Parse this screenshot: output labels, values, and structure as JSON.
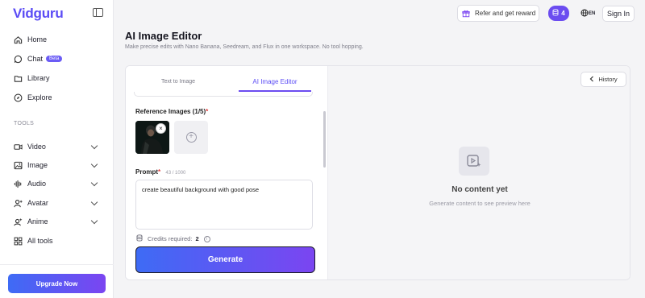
{
  "app": {
    "logo": "Vidguru"
  },
  "colors": {
    "accent": "#6b4cf0",
    "gradient_start": "#3e6bf5",
    "gradient_end": "#7b45f1",
    "required": "#e13c3c"
  },
  "sidebar": {
    "items": [
      {
        "label": "Home",
        "icon": "home-icon"
      },
      {
        "label": "Chat",
        "icon": "chat-icon",
        "badge": "Beta"
      },
      {
        "label": "Library",
        "icon": "folder-icon"
      },
      {
        "label": "Explore",
        "icon": "compass-icon"
      }
    ],
    "section_label": "TOOLS",
    "tools": [
      {
        "label": "Video",
        "icon": "video-icon"
      },
      {
        "label": "Image",
        "icon": "image-icon"
      },
      {
        "label": "Audio",
        "icon": "audio-icon"
      },
      {
        "label": "Avatar",
        "icon": "avatar-icon"
      },
      {
        "label": "Anime",
        "icon": "anime-icon"
      },
      {
        "label": "All tools",
        "icon": "grid-icon"
      }
    ],
    "upgrade_label": "Upgrade Now"
  },
  "header": {
    "refer_label": "Refer and get reward",
    "credits": "4",
    "language": "EN",
    "signin_label": "Sign In"
  },
  "page": {
    "title": "AI Image Editor",
    "subtitle": "Make precise edits with Nano Banana, Seedream, and Flux in one workspace. No tool hopping."
  },
  "editor": {
    "tabs": [
      {
        "label": "Text to Image",
        "active": false
      },
      {
        "label": "AI Image Editor",
        "active": true
      }
    ],
    "reference_label": "Reference Images (1/5)",
    "required_mark": "*",
    "prompt_label": "Prompt",
    "prompt_counter": "43 / 1000",
    "prompt_value": "create beautiful background with good pose",
    "credits_label": "Credits required:",
    "credits_value": "2",
    "generate_label": "Generate"
  },
  "preview": {
    "history_label": "History",
    "empty_title": "No content yet",
    "empty_subtitle": "Generate content to see preview here"
  }
}
